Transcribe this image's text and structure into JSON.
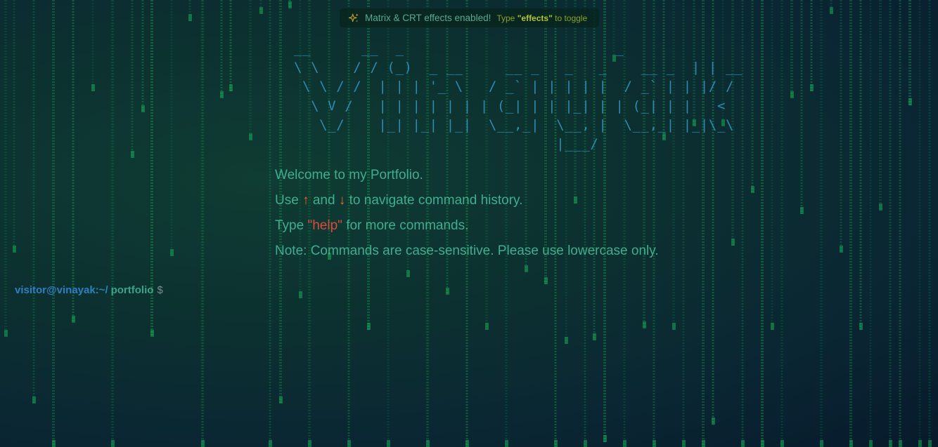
{
  "colors": {
    "background": "#0c3030",
    "rain": "#19c45a",
    "ascii": "#2f8fb8",
    "text": "#3fae8e",
    "arrow": "#e3692b",
    "help": "#e0483c",
    "prompt_user": "#2d7fc2",
    "prompt_dir": "#3aa487",
    "toast_hint": "#8aa02a"
  },
  "toast": {
    "icon": "sparkles-icon",
    "message": "Matrix & CRT effects enabled!",
    "hint_prefix": "Type",
    "hint_command": "\"effects\"",
    "hint_suffix": "to toggle"
  },
  "banner": {
    "ascii_art": "__      __  _                         _    \n\\ \\    / / (_)  _ __     __ _   _   _    __ _  | | __\n \\ \\ / /  | | | '_ \\   / _` | | | | |  / _` | | |/ /\n  \\ V /   | | | | | | | (_| | | |_| | | (_| | |   < \n   \\_/    |_| |_| |_|  \\__,_|  \\__, |  \\__,_| |_|\\_\\\n                               |___/                  "
  },
  "welcome": {
    "line1": "Welcome to my Portfolio.",
    "line2_start": "Use",
    "up_arrow": "↑",
    "line2_and": "and",
    "down_arrow": "↓",
    "line2_end": "to navigate command history.",
    "line3_start": "Type",
    "help_command": "\"help\"",
    "line3_end": "for more commands.",
    "line4": "Note: Commands are case-sensitive. Please use lowercase only."
  },
  "prompt": {
    "user_host": "visitor@vinayak:~/",
    "directory": "portfolio",
    "symbol": "$",
    "value": ""
  }
}
